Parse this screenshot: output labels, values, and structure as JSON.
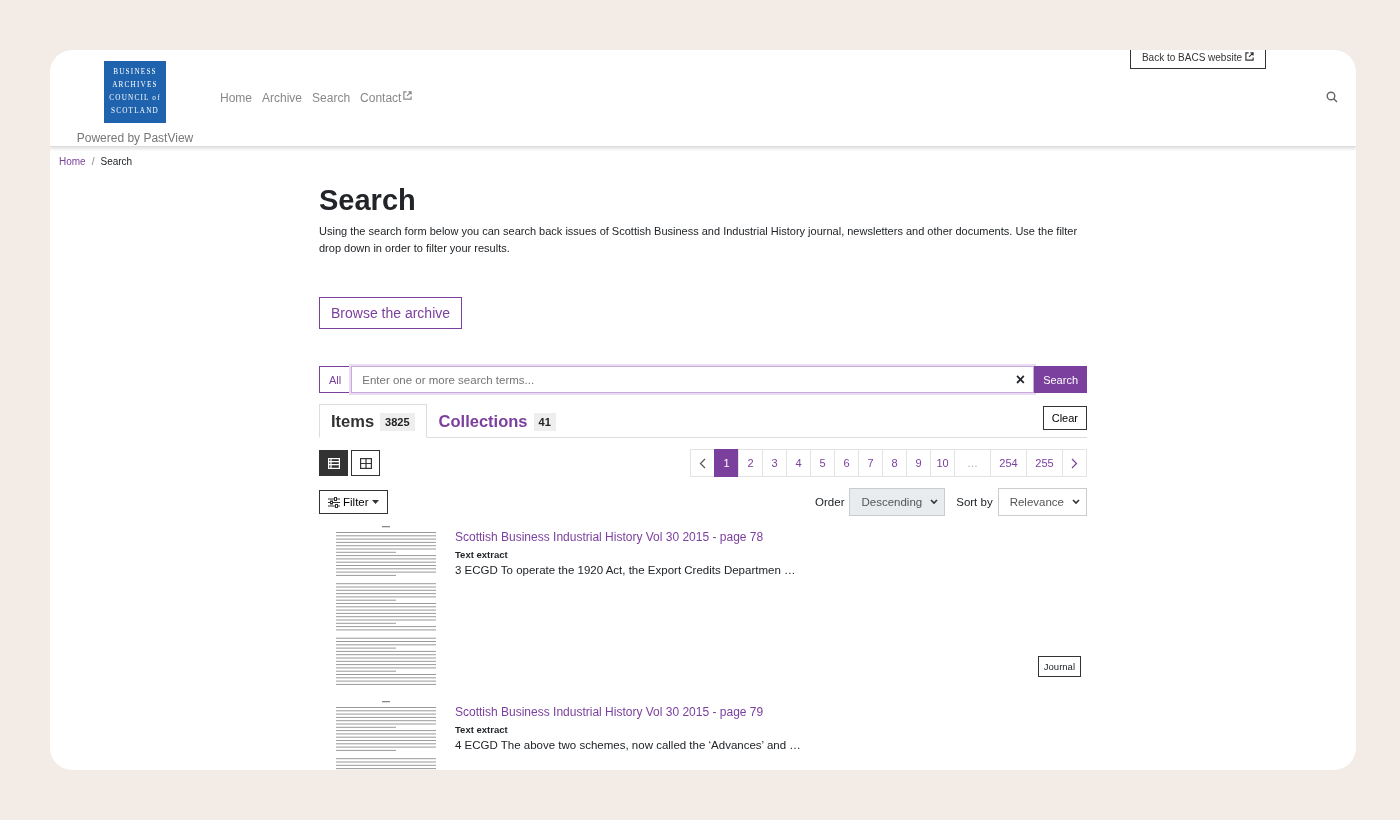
{
  "header": {
    "logo_lines": [
      "BUSINESS",
      "ARCHIVES",
      "COUNCIL of",
      "SCOTLAND"
    ],
    "powered_by": "Powered by PastView",
    "nav": [
      {
        "label": "Home",
        "external": false
      },
      {
        "label": "Archive",
        "external": false
      },
      {
        "label": "Search",
        "external": false
      },
      {
        "label": "Contact",
        "external": true
      }
    ],
    "back_link": {
      "label": "Back to BACS website",
      "external": true
    }
  },
  "breadcrumb_separator": "/",
  "breadcrumb": [
    {
      "label": "Home",
      "current": false
    },
    {
      "label": "Search",
      "current": true
    }
  ],
  "title": "Search",
  "intro": "Using the search form below you can search back issues of Scottish Business and Industrial History journal, newsletters and other documents. Use the filter drop down in order to filter your results.",
  "browse_button": "Browse the archive",
  "search": {
    "scope": "All",
    "placeholder": "Enter one or more search terms...",
    "clear_symbol": "×",
    "button": "Search"
  },
  "tabs": [
    {
      "label": "Items",
      "count": "3825",
      "selected": true
    },
    {
      "label": "Collections",
      "count": "41",
      "selected": false
    }
  ],
  "clear_button": "Clear",
  "views": [
    {
      "kind": "list",
      "selected": true
    },
    {
      "kind": "grid",
      "selected": false
    }
  ],
  "pagination": [
    {
      "kind": "prev",
      "selected": false
    },
    {
      "kind": "page",
      "label": "1",
      "selected": true
    },
    {
      "kind": "page",
      "label": "2",
      "selected": false
    },
    {
      "kind": "page",
      "label": "3",
      "selected": false
    },
    {
      "kind": "page",
      "label": "4",
      "selected": false
    },
    {
      "kind": "page",
      "label": "5",
      "selected": false
    },
    {
      "kind": "page",
      "label": "6",
      "selected": false
    },
    {
      "kind": "page",
      "label": "7",
      "selected": false
    },
    {
      "kind": "page",
      "label": "8",
      "selected": false
    },
    {
      "kind": "page",
      "label": "9",
      "selected": false
    },
    {
      "kind": "page",
      "label": "10",
      "selected": false
    },
    {
      "kind": "ellipsis",
      "label": "…",
      "selected": false
    },
    {
      "kind": "page",
      "label": "254",
      "selected": false
    },
    {
      "kind": "page",
      "label": "255",
      "selected": false
    },
    {
      "kind": "next",
      "selected": false
    }
  ],
  "filter_button": "Filter",
  "order": {
    "label": "Order",
    "value": "Descending"
  },
  "sort": {
    "label": "Sort by",
    "value": "Relevance"
  },
  "results": [
    {
      "title": "Scottish Business Industrial History Vol 30 2015 - page 78",
      "extract_label": "Text extract",
      "extract": "3 ECGD To operate the 1920 Act, the Export Credits Departmen …",
      "tag": "Journal"
    },
    {
      "title": "Scottish Business Industrial History Vol 30 2015 - page 79",
      "extract_label": "Text extract",
      "extract": "4 ECGD The above two schemes, now called the ‘Advances’ and …"
    }
  ]
}
